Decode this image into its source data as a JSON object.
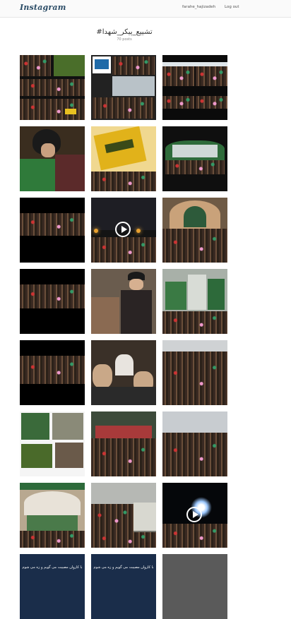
{
  "topbar": {
    "logo": "Instagram",
    "username": "farahe_hajizadeh",
    "logout": "Log out"
  },
  "header": {
    "hashtag": "#تشییع_پیکر_شهدا",
    "post_count": "70 posts"
  },
  "tiles": [
    {
      "kind": "collage-crowd"
    },
    {
      "kind": "collage-logo"
    },
    {
      "kind": "crowd-split"
    },
    {
      "kind": "leader-kiss"
    },
    {
      "kind": "yellow-flag"
    },
    {
      "kind": "green-arch"
    },
    {
      "kind": "night-crowd"
    },
    {
      "kind": "video-stage",
      "video": true
    },
    {
      "kind": "arch-crowd"
    },
    {
      "kind": "night-crowd-2"
    },
    {
      "kind": "leader-portrait"
    },
    {
      "kind": "flags-crowd"
    },
    {
      "kind": "night-crowd-3"
    },
    {
      "kind": "selfie-clerics"
    },
    {
      "kind": "aerial-crowd"
    },
    {
      "kind": "coffins-collage"
    },
    {
      "kind": "street-crowd"
    },
    {
      "kind": "procession"
    },
    {
      "kind": "arch-coffins"
    },
    {
      "kind": "aerial-city"
    },
    {
      "kind": "video-night",
      "video": true
    }
  ],
  "bottom_captions": [
    "با کاروان مصیبت می گویم و زه می شوم",
    "با کاروان مصیبت می گویم و زه می شوم",
    ""
  ]
}
